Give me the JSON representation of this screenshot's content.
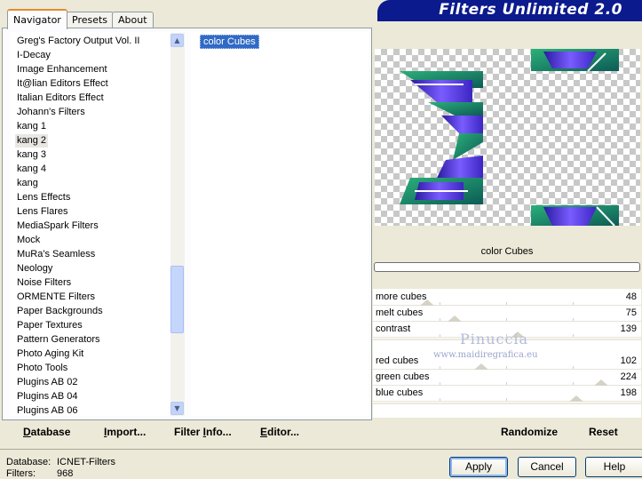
{
  "app": {
    "title": "Filters Unlimited 2.0"
  },
  "tabs": [
    {
      "label": "Navigator",
      "active": true
    },
    {
      "label": "Presets",
      "active": false
    },
    {
      "label": "About",
      "active": false
    }
  ],
  "categories": [
    {
      "label": "Greg's Factory Output Vol. II"
    },
    {
      "label": "I-Decay"
    },
    {
      "label": "Image Enhancement"
    },
    {
      "label": "It@lian Editors Effect"
    },
    {
      "label": "Italian Editors Effect"
    },
    {
      "label": "Johann's Filters"
    },
    {
      "label": "kang 1"
    },
    {
      "label": "kang 2",
      "selected": true
    },
    {
      "label": "kang 3"
    },
    {
      "label": "kang 4"
    },
    {
      "label": "kang"
    },
    {
      "label": "Lens Effects"
    },
    {
      "label": "Lens Flares"
    },
    {
      "label": "MediaSpark Filters"
    },
    {
      "label": "Mock"
    },
    {
      "label": "MuRa's Seamless"
    },
    {
      "label": "Neology"
    },
    {
      "label": "Noise Filters"
    },
    {
      "label": "ORMENTE Filters"
    },
    {
      "label": "Paper Backgrounds"
    },
    {
      "label": "Paper Textures"
    },
    {
      "label": "Pattern Generators"
    },
    {
      "label": "Photo Aging Kit"
    },
    {
      "label": "Photo Tools"
    },
    {
      "label": "Plugins AB 02"
    },
    {
      "label": "Plugins AB 04"
    },
    {
      "label": "Plugins AB 06"
    }
  ],
  "filters": [
    {
      "label": "color Cubes",
      "selected": true
    }
  ],
  "preview": {
    "filter_name": "color Cubes"
  },
  "sliders": [
    {
      "label": "more cubes",
      "value": 48
    },
    {
      "label": "melt cubes",
      "value": 75
    },
    {
      "label": "contrast",
      "value": 139
    },
    {
      "label": "red cubes",
      "value": 102
    },
    {
      "label": "green cubes",
      "value": 224
    },
    {
      "label": "blue cubes",
      "value": 198
    }
  ],
  "watermark": {
    "name": "Pinuccia",
    "url": "www.maidiregrafica.eu"
  },
  "toolbar": {
    "database": {
      "u": "D",
      "rest": "atabase"
    },
    "import": {
      "pre": "",
      "u": "I",
      "rest": "mport..."
    },
    "filter_info": {
      "pre": "Filter ",
      "u": "I",
      "rest": "nfo..."
    },
    "editor": {
      "u": "E",
      "rest": "ditor..."
    },
    "randomize": "Randomize",
    "reset": "Reset"
  },
  "status": {
    "database_label": "Database:",
    "database_value": "ICNET-Filters",
    "filters_label": "Filters:",
    "filters_value": "968"
  },
  "buttons": {
    "apply": "Apply",
    "cancel": "Cancel",
    "help": "Help"
  },
  "colors": {
    "banner": "#0b1a8c",
    "selection": "#316ac5",
    "tab_accent": "#e68b2c"
  }
}
